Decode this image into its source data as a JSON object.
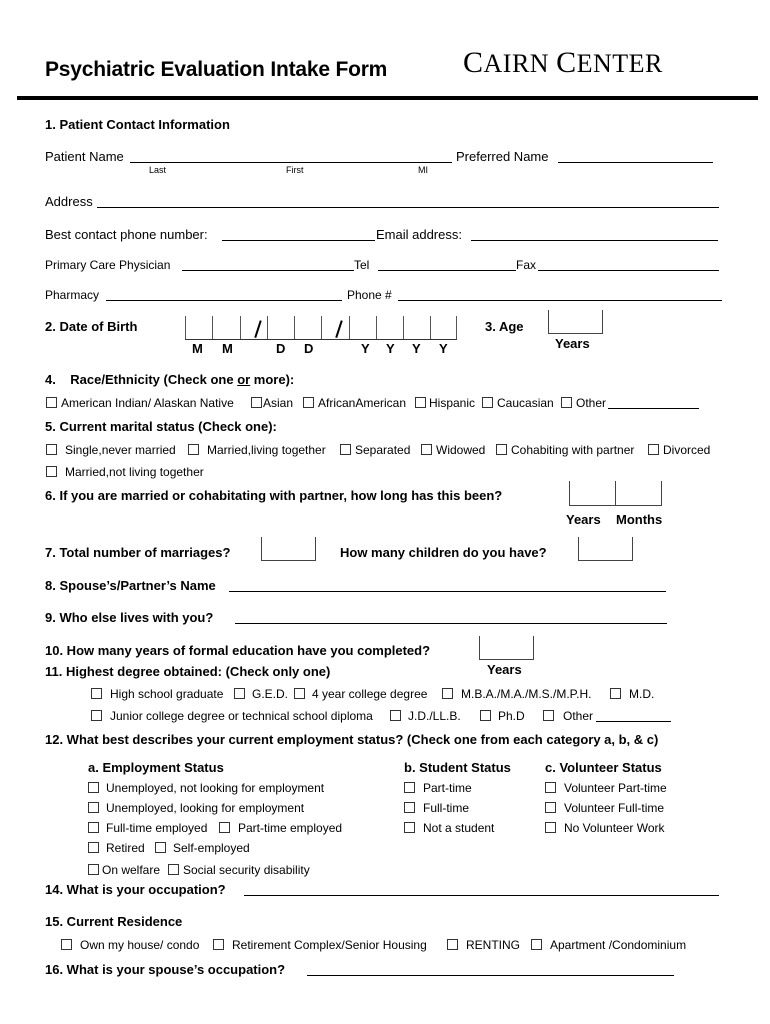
{
  "header": {
    "title": "Psychiatric Evaluation Intake Form",
    "logo": {
      "first_initial": "C",
      "first_rest": "AIRN",
      "second_initial": "C",
      "second_rest": "ENTER"
    }
  },
  "section1": {
    "heading": "1. Patient Contact Information",
    "patient_name_label": "Patient Name",
    "name_sublabels": {
      "last": "Last",
      "first": "First",
      "mi": "MI"
    },
    "preferred_name_label": "Preferred Name",
    "address_label": "Address",
    "phone_label": "Best contact phone number:",
    "email_label": "Email address:",
    "pcp_label": "Primary Care Physician",
    "tel_label": "Tel",
    "fax_label": "Fax",
    "pharmacy_label": "Pharmacy",
    "pharmacy_phone_label": "Phone #"
  },
  "section2": {
    "heading": "2.   Date of Birth",
    "cell_labels": [
      "M",
      "M",
      "D",
      "D",
      "Y",
      "Y",
      "Y",
      "Y"
    ],
    "separator": "/"
  },
  "section3": {
    "heading": "3.  Age",
    "unit": "Years"
  },
  "section4": {
    "num": "4.",
    "heading_pre": "Race/Ethnicity (Check one ",
    "heading_or": "or",
    "heading_post": " more):",
    "options": [
      "American Indian/ Alaskan Native",
      "Asian",
      "AfricanAmerican",
      "Hispanic",
      "Caucasian",
      "Other"
    ]
  },
  "section5": {
    "heading": "5.   Current marital status (Check one):",
    "options": [
      "Single,never married",
      "Married,living together",
      "Separated",
      "Widowed",
      "Cohabiting with partner",
      "Divorced",
      "Married,not living together"
    ]
  },
  "section6": {
    "heading": "6.   If you are married or cohabitating with partner, how long has this been?",
    "units": [
      "Years",
      "Months"
    ]
  },
  "section7": {
    "heading": "7.   Total number of  marriages?",
    "children_label": "How many children do you have?"
  },
  "section8": {
    "heading": "8. Spouse’s/Partner’s Name"
  },
  "section9": {
    "heading": "9.  Who else lives with you?"
  },
  "section10": {
    "heading": "10.  How many years of formal education have you completed?",
    "unit": "Years"
  },
  "section11": {
    "heading": "11.  Highest degree obtained: (Check only one)",
    "row1": [
      "High school graduate",
      "G.E.D.",
      "4 year college degree",
      "M.B.A./M.A./M.S./M.P.H.",
      "M.D."
    ],
    "row2": [
      "Junior college degree or technical school diploma",
      "J.D./LL.B.",
      "Ph.D",
      "Other"
    ]
  },
  "section12": {
    "heading": "12. What best describes your current employment status? (Check one from each category a, b, & c)",
    "employment": {
      "heading": "a.  Employment Status",
      "options": [
        "Unemployed, not looking for employment",
        "Unemployed, looking for employment",
        "Full-time employed",
        "Part-time employed",
        "Retired",
        "Self-employed",
        "On welfare",
        "Social security disability"
      ]
    },
    "student": {
      "heading": "b.  Student Status",
      "options": [
        "Part-time",
        "Full-time",
        "Not a student"
      ]
    },
    "volunteer": {
      "heading": "c. Volunteer Status",
      "options": [
        "Volunteer Part-time",
        "Volunteer Full-time",
        "No Volunteer Work"
      ]
    }
  },
  "section14": {
    "heading": "14. What is your occupation?"
  },
  "section15": {
    "heading": "15. Current Residence",
    "options": [
      "Own my house/ condo",
      "Retirement Complex/Senior Housing",
      "RENTING",
      "Apartment /Condominium"
    ]
  },
  "section16": {
    "heading": "16. What is your spouse’s occupation?"
  }
}
